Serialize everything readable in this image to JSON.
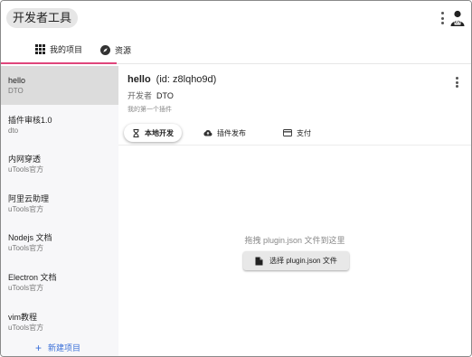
{
  "app": {
    "title": "开发者工具",
    "avatar_icon": "developer-avatar-icon"
  },
  "tabs": [
    {
      "label": "我的项目",
      "icon": "grid-icon",
      "active": true
    },
    {
      "label": "资源",
      "icon": "compass-icon",
      "active": false
    }
  ],
  "sidebar": {
    "items": [
      {
        "name": "hello",
        "sub": "DTO",
        "selected": true
      },
      {
        "name": "插件审核1.0",
        "sub": "dto"
      },
      {
        "name": "内网穿透",
        "sub": "uTools官方"
      },
      {
        "name": "阿里云助理",
        "sub": "uTools官方"
      },
      {
        "name": "Nodejs 文档",
        "sub": "uTools官方"
      },
      {
        "name": "Electron 文档",
        "sub": "uTools官方"
      },
      {
        "name": "vim教程",
        "sub": "uTools官方"
      }
    ],
    "new_project": "新建项目"
  },
  "plugin": {
    "name": "hello",
    "id": "(id: z8lqho9d)",
    "developer_label": "开发者",
    "developer": "DTO",
    "description": "我的第一个插件"
  },
  "subtabs": [
    {
      "label": "本地开发",
      "icon": "hourglass-icon",
      "active": true
    },
    {
      "label": "插件发布",
      "icon": "cloud-upload-icon"
    },
    {
      "label": "支付",
      "icon": "credit-card-icon"
    }
  ],
  "dropzone": {
    "hint": "拖拽 plugin.json 文件到这里",
    "button": "选择 plugin.json 文件",
    "button_icon": "file-icon"
  },
  "colors": {
    "accent_tab": "#e0457b",
    "link": "#3a6fd8",
    "sidebar_bg": "#f7f7f9",
    "selected_bg": "#dcdcdc"
  }
}
